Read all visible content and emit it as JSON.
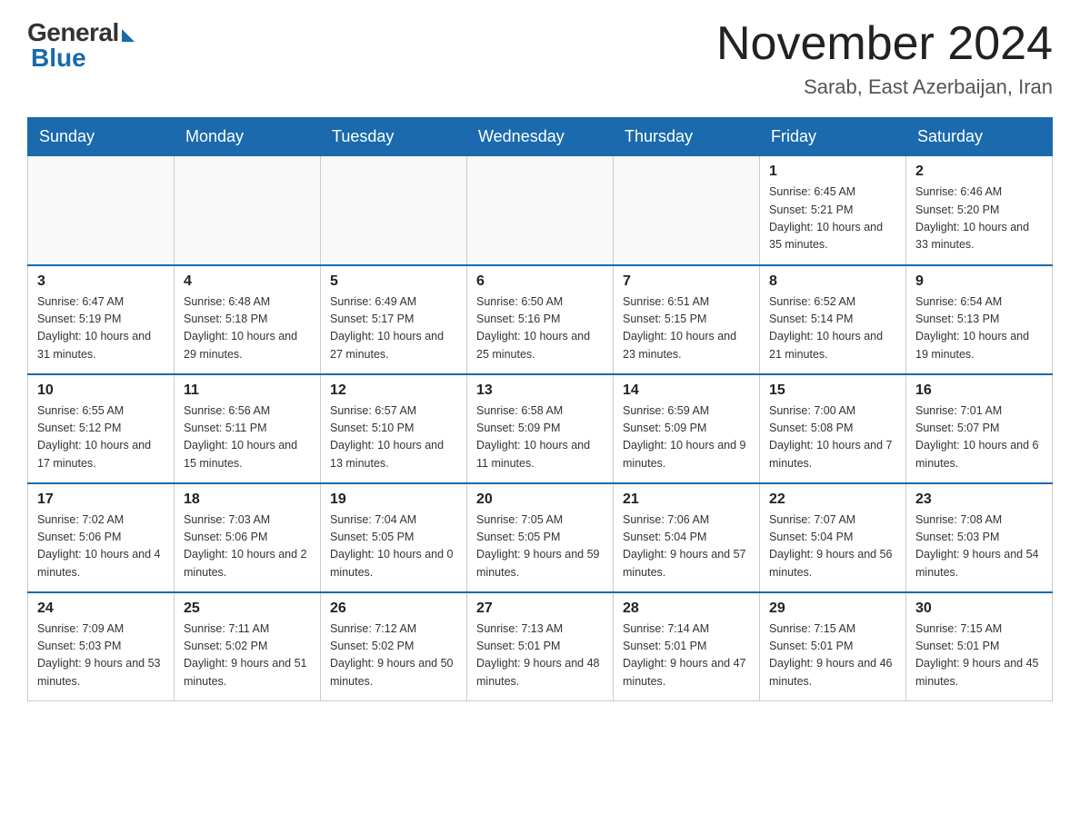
{
  "header": {
    "logo_general": "General",
    "logo_blue": "Blue",
    "month_title": "November 2024",
    "location": "Sarab, East Azerbaijan, Iran"
  },
  "weekdays": [
    "Sunday",
    "Monday",
    "Tuesday",
    "Wednesday",
    "Thursday",
    "Friday",
    "Saturday"
  ],
  "weeks": [
    [
      {
        "day": "",
        "sunrise": "",
        "sunset": "",
        "daylight": "",
        "empty": true
      },
      {
        "day": "",
        "sunrise": "",
        "sunset": "",
        "daylight": "",
        "empty": true
      },
      {
        "day": "",
        "sunrise": "",
        "sunset": "",
        "daylight": "",
        "empty": true
      },
      {
        "day": "",
        "sunrise": "",
        "sunset": "",
        "daylight": "",
        "empty": true
      },
      {
        "day": "",
        "sunrise": "",
        "sunset": "",
        "daylight": "",
        "empty": true
      },
      {
        "day": "1",
        "sunrise": "Sunrise: 6:45 AM",
        "sunset": "Sunset: 5:21 PM",
        "daylight": "Daylight: 10 hours and 35 minutes.",
        "empty": false
      },
      {
        "day": "2",
        "sunrise": "Sunrise: 6:46 AM",
        "sunset": "Sunset: 5:20 PM",
        "daylight": "Daylight: 10 hours and 33 minutes.",
        "empty": false
      }
    ],
    [
      {
        "day": "3",
        "sunrise": "Sunrise: 6:47 AM",
        "sunset": "Sunset: 5:19 PM",
        "daylight": "Daylight: 10 hours and 31 minutes.",
        "empty": false
      },
      {
        "day": "4",
        "sunrise": "Sunrise: 6:48 AM",
        "sunset": "Sunset: 5:18 PM",
        "daylight": "Daylight: 10 hours and 29 minutes.",
        "empty": false
      },
      {
        "day": "5",
        "sunrise": "Sunrise: 6:49 AM",
        "sunset": "Sunset: 5:17 PM",
        "daylight": "Daylight: 10 hours and 27 minutes.",
        "empty": false
      },
      {
        "day": "6",
        "sunrise": "Sunrise: 6:50 AM",
        "sunset": "Sunset: 5:16 PM",
        "daylight": "Daylight: 10 hours and 25 minutes.",
        "empty": false
      },
      {
        "day": "7",
        "sunrise": "Sunrise: 6:51 AM",
        "sunset": "Sunset: 5:15 PM",
        "daylight": "Daylight: 10 hours and 23 minutes.",
        "empty": false
      },
      {
        "day": "8",
        "sunrise": "Sunrise: 6:52 AM",
        "sunset": "Sunset: 5:14 PM",
        "daylight": "Daylight: 10 hours and 21 minutes.",
        "empty": false
      },
      {
        "day": "9",
        "sunrise": "Sunrise: 6:54 AM",
        "sunset": "Sunset: 5:13 PM",
        "daylight": "Daylight: 10 hours and 19 minutes.",
        "empty": false
      }
    ],
    [
      {
        "day": "10",
        "sunrise": "Sunrise: 6:55 AM",
        "sunset": "Sunset: 5:12 PM",
        "daylight": "Daylight: 10 hours and 17 minutes.",
        "empty": false
      },
      {
        "day": "11",
        "sunrise": "Sunrise: 6:56 AM",
        "sunset": "Sunset: 5:11 PM",
        "daylight": "Daylight: 10 hours and 15 minutes.",
        "empty": false
      },
      {
        "day": "12",
        "sunrise": "Sunrise: 6:57 AM",
        "sunset": "Sunset: 5:10 PM",
        "daylight": "Daylight: 10 hours and 13 minutes.",
        "empty": false
      },
      {
        "day": "13",
        "sunrise": "Sunrise: 6:58 AM",
        "sunset": "Sunset: 5:09 PM",
        "daylight": "Daylight: 10 hours and 11 minutes.",
        "empty": false
      },
      {
        "day": "14",
        "sunrise": "Sunrise: 6:59 AM",
        "sunset": "Sunset: 5:09 PM",
        "daylight": "Daylight: 10 hours and 9 minutes.",
        "empty": false
      },
      {
        "day": "15",
        "sunrise": "Sunrise: 7:00 AM",
        "sunset": "Sunset: 5:08 PM",
        "daylight": "Daylight: 10 hours and 7 minutes.",
        "empty": false
      },
      {
        "day": "16",
        "sunrise": "Sunrise: 7:01 AM",
        "sunset": "Sunset: 5:07 PM",
        "daylight": "Daylight: 10 hours and 6 minutes.",
        "empty": false
      }
    ],
    [
      {
        "day": "17",
        "sunrise": "Sunrise: 7:02 AM",
        "sunset": "Sunset: 5:06 PM",
        "daylight": "Daylight: 10 hours and 4 minutes.",
        "empty": false
      },
      {
        "day": "18",
        "sunrise": "Sunrise: 7:03 AM",
        "sunset": "Sunset: 5:06 PM",
        "daylight": "Daylight: 10 hours and 2 minutes.",
        "empty": false
      },
      {
        "day": "19",
        "sunrise": "Sunrise: 7:04 AM",
        "sunset": "Sunset: 5:05 PM",
        "daylight": "Daylight: 10 hours and 0 minutes.",
        "empty": false
      },
      {
        "day": "20",
        "sunrise": "Sunrise: 7:05 AM",
        "sunset": "Sunset: 5:05 PM",
        "daylight": "Daylight: 9 hours and 59 minutes.",
        "empty": false
      },
      {
        "day": "21",
        "sunrise": "Sunrise: 7:06 AM",
        "sunset": "Sunset: 5:04 PM",
        "daylight": "Daylight: 9 hours and 57 minutes.",
        "empty": false
      },
      {
        "day": "22",
        "sunrise": "Sunrise: 7:07 AM",
        "sunset": "Sunset: 5:04 PM",
        "daylight": "Daylight: 9 hours and 56 minutes.",
        "empty": false
      },
      {
        "day": "23",
        "sunrise": "Sunrise: 7:08 AM",
        "sunset": "Sunset: 5:03 PM",
        "daylight": "Daylight: 9 hours and 54 minutes.",
        "empty": false
      }
    ],
    [
      {
        "day": "24",
        "sunrise": "Sunrise: 7:09 AM",
        "sunset": "Sunset: 5:03 PM",
        "daylight": "Daylight: 9 hours and 53 minutes.",
        "empty": false
      },
      {
        "day": "25",
        "sunrise": "Sunrise: 7:11 AM",
        "sunset": "Sunset: 5:02 PM",
        "daylight": "Daylight: 9 hours and 51 minutes.",
        "empty": false
      },
      {
        "day": "26",
        "sunrise": "Sunrise: 7:12 AM",
        "sunset": "Sunset: 5:02 PM",
        "daylight": "Daylight: 9 hours and 50 minutes.",
        "empty": false
      },
      {
        "day": "27",
        "sunrise": "Sunrise: 7:13 AM",
        "sunset": "Sunset: 5:01 PM",
        "daylight": "Daylight: 9 hours and 48 minutes.",
        "empty": false
      },
      {
        "day": "28",
        "sunrise": "Sunrise: 7:14 AM",
        "sunset": "Sunset: 5:01 PM",
        "daylight": "Daylight: 9 hours and 47 minutes.",
        "empty": false
      },
      {
        "day": "29",
        "sunrise": "Sunrise: 7:15 AM",
        "sunset": "Sunset: 5:01 PM",
        "daylight": "Daylight: 9 hours and 46 minutes.",
        "empty": false
      },
      {
        "day": "30",
        "sunrise": "Sunrise: 7:15 AM",
        "sunset": "Sunset: 5:01 PM",
        "daylight": "Daylight: 9 hours and 45 minutes.",
        "empty": false
      }
    ]
  ]
}
